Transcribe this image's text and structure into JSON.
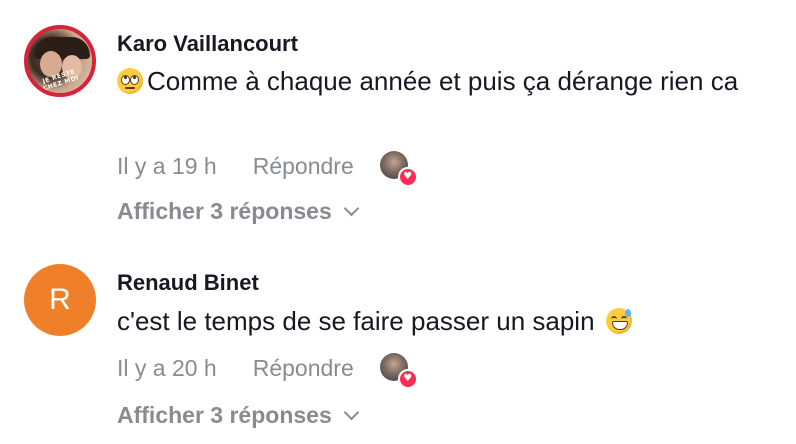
{
  "comments": [
    {
      "username": "Karo Vaillancourt",
      "avatar_type": "photo",
      "avatar_text": "JE RESTE CHEZ MOI",
      "emoji": "face-with-rolling-eyes",
      "text": "Comme à chaque année et puis ça dérange rien ca",
      "time": "Il y a 19 h",
      "reply_label": "Répondre",
      "liked_by_creator": true,
      "view_replies_label": "Afficher 3 réponses"
    },
    {
      "username": "Renaud Binet",
      "avatar_type": "letter",
      "avatar_letter": "R",
      "avatar_color": "#f07f2a",
      "emoji": "grinning-face-with-sweat",
      "text": "c'est le temps de se faire passer un sapin",
      "time": "Il y a 20 h",
      "reply_label": "Répondre",
      "liked_by_creator": true,
      "view_replies_label": "Afficher 3 réponses"
    }
  ],
  "colors": {
    "text_primary": "#161823",
    "text_secondary": "#8a8b91",
    "heart": "#fe2c55"
  }
}
